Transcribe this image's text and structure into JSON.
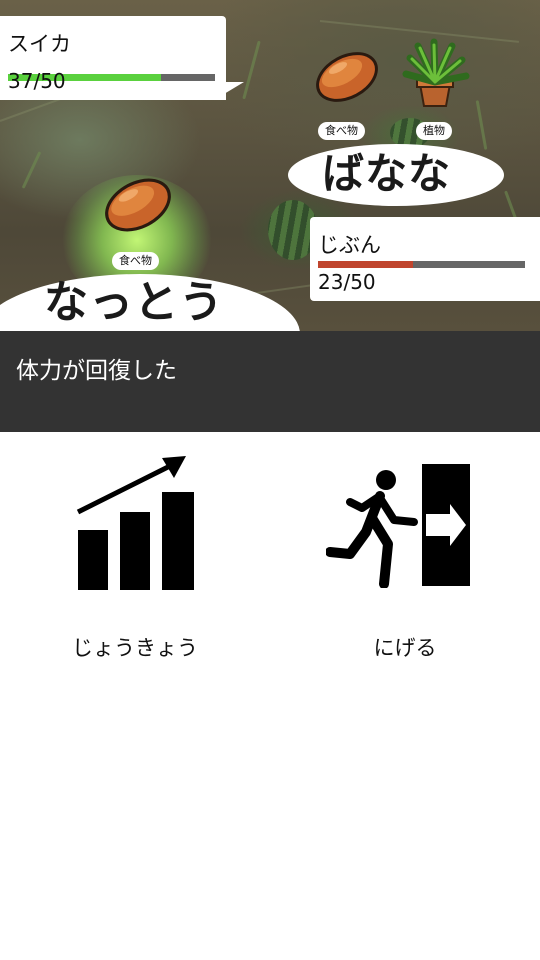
{
  "enemy": {
    "name": "スイカ",
    "hp_text": "37/50",
    "hp_current": 37,
    "hp_max": 50,
    "hp_color": "#5ad13e",
    "monster_name": "ばなな",
    "tags": [
      "食べ物",
      "植物"
    ],
    "sprites": [
      "bread-icon",
      "potted-plant-icon"
    ]
  },
  "player": {
    "name": "じぶん",
    "hp_text": "23/50",
    "hp_current": 23,
    "hp_max": 50,
    "hp_color": "#c0452e",
    "monster_name": "なっとう",
    "tags": [
      "食べ物"
    ],
    "sprites": [
      "bread-icon"
    ]
  },
  "message": "体力が回復した",
  "commands": [
    {
      "label": "じょうきょう",
      "icon": "growth-chart-icon"
    },
    {
      "label": "にげる",
      "icon": "exit-running-icon"
    }
  ],
  "colors": {
    "message_bg": "#333333",
    "hp_track": "#666666"
  }
}
